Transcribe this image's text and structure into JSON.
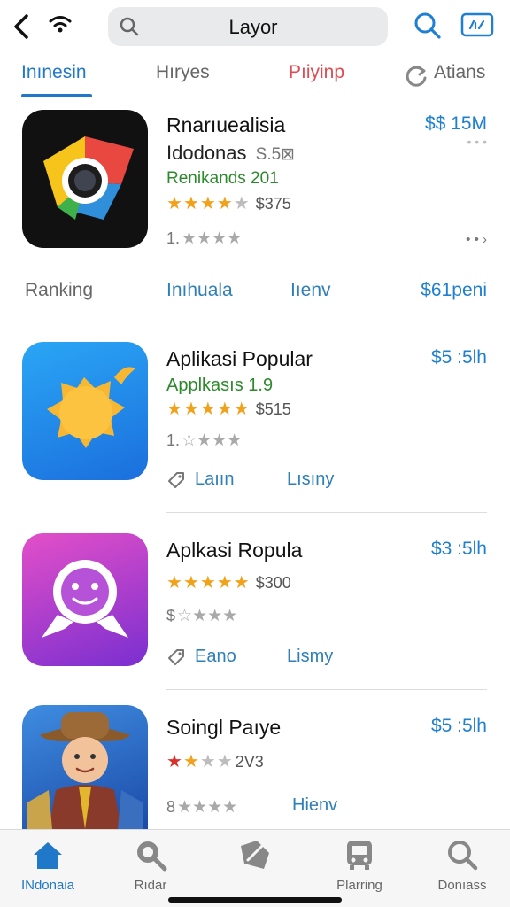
{
  "header": {
    "search_title": "Layor",
    "icons": [
      "back-icon",
      "wifi-icon",
      "search-icon",
      "chat-icon"
    ]
  },
  "tabs": [
    {
      "label": "Inınesin"
    },
    {
      "label": "Hıryes"
    },
    {
      "label": "Pıiyinp"
    },
    {
      "label": "Atians"
    }
  ],
  "apps": [
    {
      "title": "Rnarıuealisia",
      "price": "$$ 15M",
      "price_sub": "• • •",
      "subtitle": "Idodonas",
      "subtitle_extra": "S.5⊠",
      "category": "Renikands 201",
      "rating_value": "$375",
      "rating_stars": 4,
      "meta_prefix": "1.",
      "chevron": "• • ›"
    },
    {
      "title": "Aplikasi Popular",
      "price": "$5 :5lh",
      "category": "Applkasıs 1.9",
      "rating_value": "$515",
      "rating_stars": 5,
      "meta_prefix": "1.",
      "action_label": "Laıın",
      "link_label": "Lısıny"
    },
    {
      "title": "Aplkasi Ropula",
      "price": "$3 :5lh",
      "rating_value": "$300",
      "rating_stars": 5,
      "meta_prefix": "$",
      "action_label": "Eano",
      "link_label": "Lismy"
    },
    {
      "title": "Soingl Paıye",
      "price": "$5 :5lh",
      "rating_value": "2V3",
      "rating_stars": 2,
      "meta_prefix": "8",
      "link_label": "Hienv"
    }
  ],
  "ranking_row": {
    "label": "Ranking",
    "item1": "Inıhuala",
    "item2": "Iıenv",
    "item3": "$61peni"
  },
  "bottom_nav": [
    {
      "label": "INdonaia",
      "icon": "home-icon",
      "active": true
    },
    {
      "label": "Rıdar",
      "icon": "search-icon",
      "active": false
    },
    {
      "label": "",
      "icon": "edit-icon",
      "active": false
    },
    {
      "label": "Plarring",
      "icon": "bus-icon",
      "active": false
    },
    {
      "label": "Donıass",
      "icon": "search-icon",
      "active": false
    }
  ],
  "colors": {
    "accent": "#1f78c8",
    "price": "#1f7fd0",
    "tab_red": "#e04a52",
    "star": "#f2a11a"
  }
}
